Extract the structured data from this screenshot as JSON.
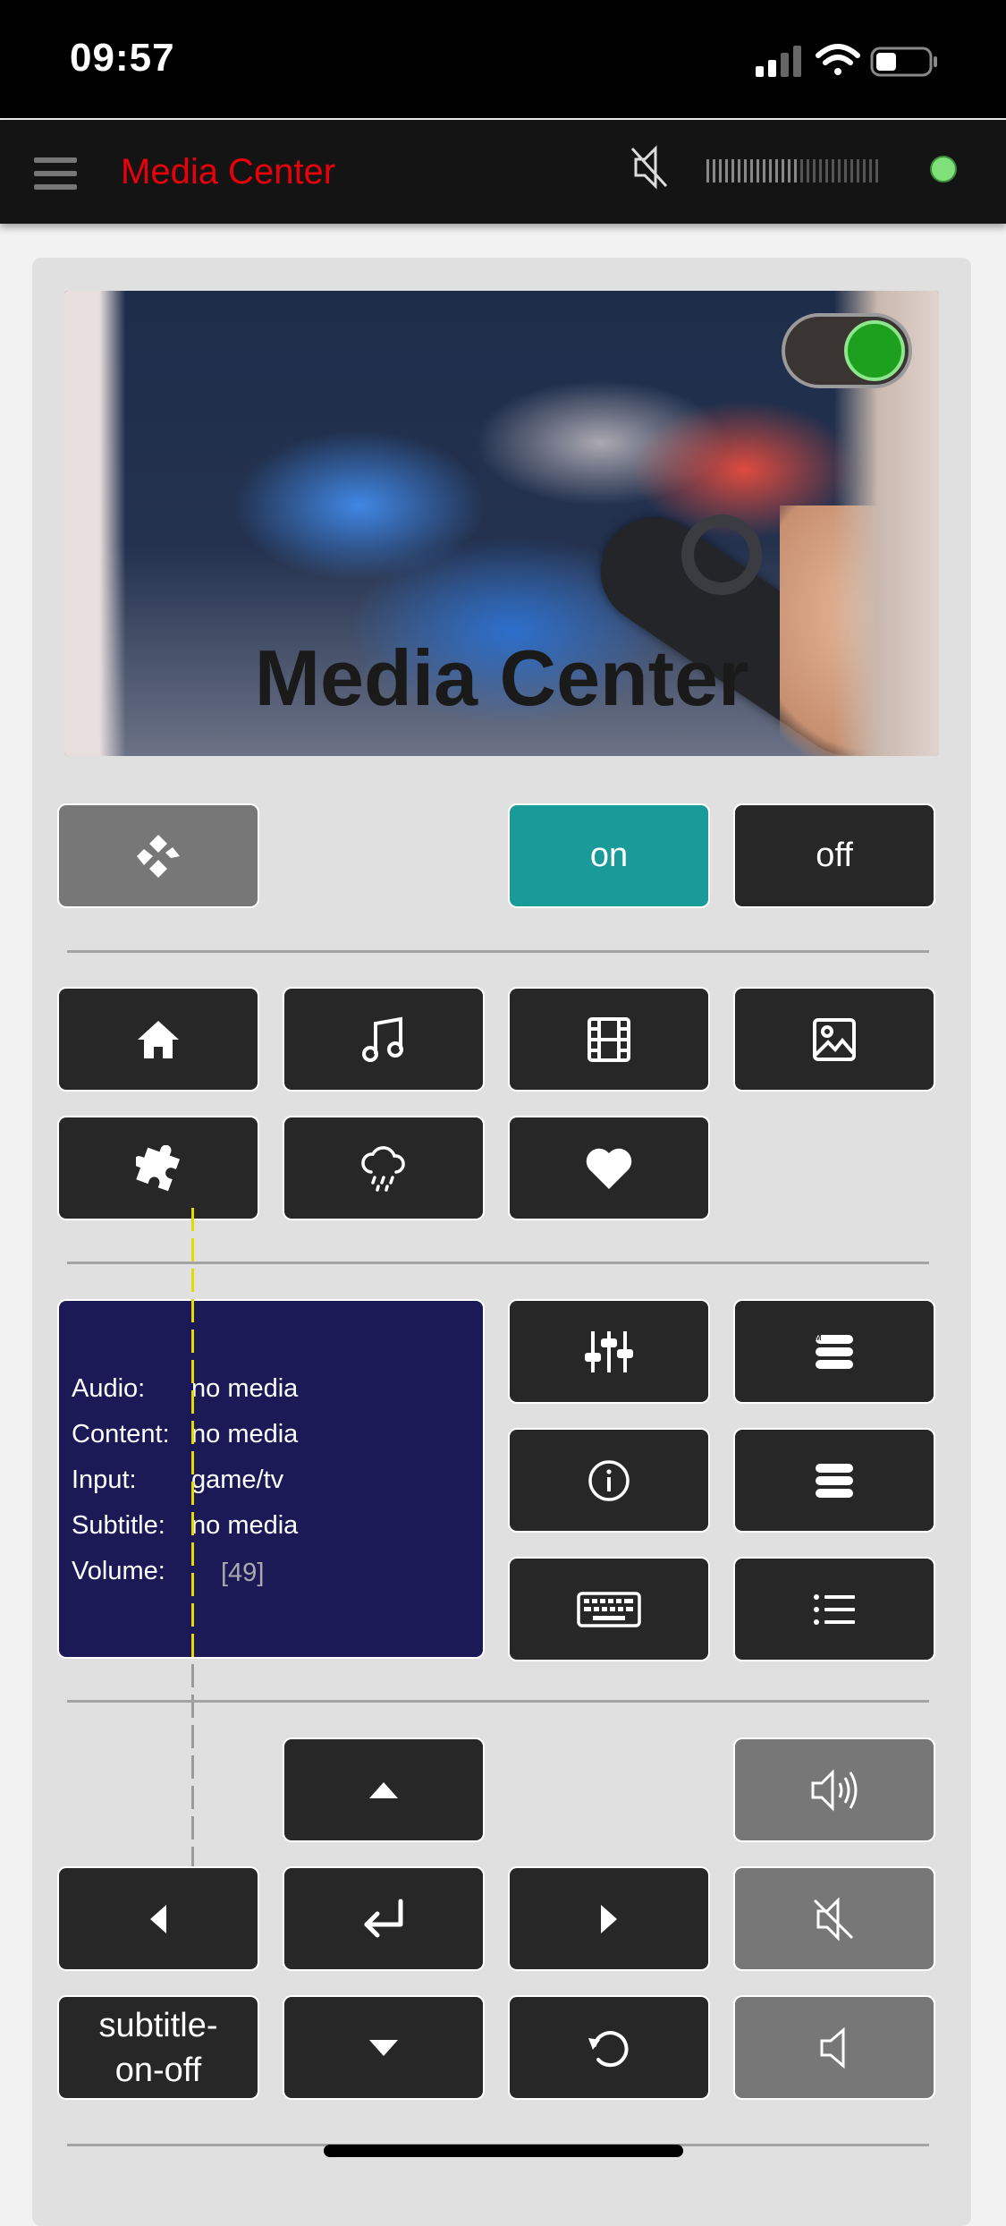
{
  "status_bar": {
    "time": "09:57"
  },
  "app_bar": {
    "title": "Media Center"
  },
  "hero": {
    "title": "Media Center",
    "power_toggle_on": true
  },
  "power": {
    "on_label": "on",
    "off_label": "off"
  },
  "info": {
    "rows": [
      {
        "key": "Audio:",
        "value": "no media"
      },
      {
        "key": "Content:",
        "value": "no media"
      },
      {
        "key": "Input:",
        "value": "game/tv"
      },
      {
        "key": "Subtitle:",
        "value": "no media"
      }
    ],
    "volume_key": "Volume:",
    "volume_value": "[49]",
    "volume_level": 49
  },
  "subtitle_button": {
    "line1": "subtitle-",
    "line2": "on-off"
  },
  "colors": {
    "accent_red": "#e8000a",
    "teal": "#1a9a98",
    "info_bg": "#1c1a56",
    "volume_yellow": "#e6d800",
    "status_green": "#7fe07a"
  }
}
